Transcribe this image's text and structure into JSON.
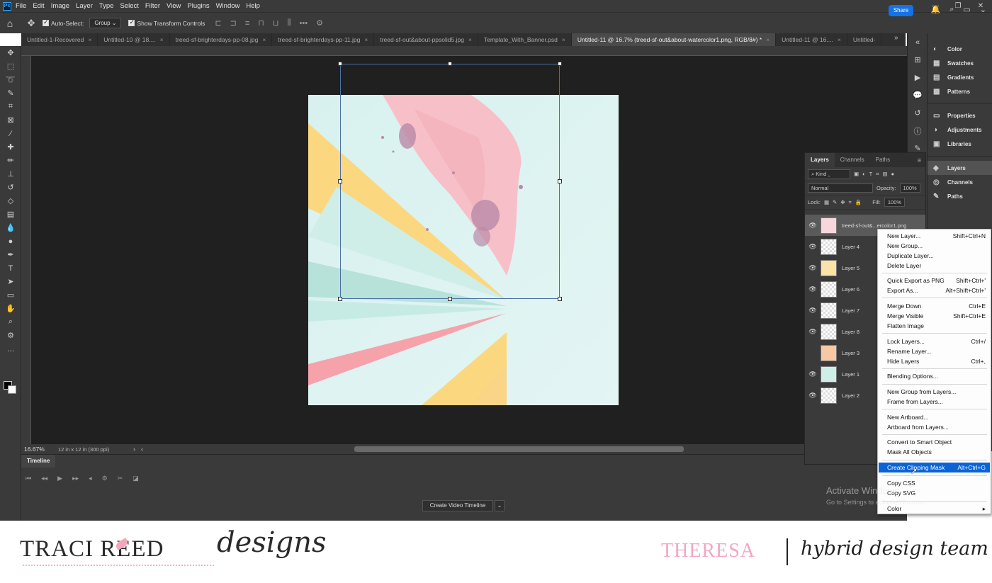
{
  "menubar": {
    "items": [
      "File",
      "Edit",
      "Image",
      "Layer",
      "Type",
      "Select",
      "Filter",
      "View",
      "Plugins",
      "Window",
      "Help"
    ],
    "window_controls": [
      "—",
      "❐",
      "✕"
    ]
  },
  "options": {
    "auto_select_label": "Auto-Select:",
    "auto_select_value": "Group",
    "show_transform_label": "Show Transform Controls",
    "share_label": "Share"
  },
  "tabs": [
    {
      "label": "Untitled-1-Recovered",
      "active": false
    },
    {
      "label": "Untitled-10 @ 18....",
      "active": false
    },
    {
      "label": "treed-sf-brighterdays-pp-08.jpg",
      "active": false
    },
    {
      "label": "treed-sf-brighterdays-pp-11.jpg",
      "active": false
    },
    {
      "label": "treed-sf-out&about-ppsolid5.jpg",
      "active": false
    },
    {
      "label": "Template_With_Banner.psd",
      "active": false
    },
    {
      "label": "Untitled-11 @ 16.7% (treed-sf-out&about-watercolor1.png, RGB/8#) *",
      "active": true
    },
    {
      "label": "Untitled-11 @ 16....",
      "active": false
    },
    {
      "label": "Untitled-",
      "active": false
    }
  ],
  "status": {
    "zoom": "16.67%",
    "doc_info": "12 in x 12 in (300 ppi)"
  },
  "timeline": {
    "tab_label": "Timeline",
    "create_button": "Create Video Timeline"
  },
  "dock": {
    "items": [
      {
        "icon": "color-icon",
        "glyph": "◐",
        "label": "Color"
      },
      {
        "icon": "swatches-icon",
        "glyph": "▦",
        "label": "Swatches"
      },
      {
        "icon": "gradients-icon",
        "glyph": "▤",
        "label": "Gradients"
      },
      {
        "icon": "patterns-icon",
        "glyph": "▩",
        "label": "Patterns"
      },
      {
        "icon": "properties-icon",
        "glyph": "▭",
        "label": "Properties"
      },
      {
        "icon": "adjustments-icon",
        "glyph": "◑",
        "label": "Adjustments"
      },
      {
        "icon": "libraries-icon",
        "glyph": "▣",
        "label": "Libraries"
      },
      {
        "icon": "layers-icon",
        "glyph": "◈",
        "label": "Layers"
      },
      {
        "icon": "channels-icon",
        "glyph": "◎",
        "label": "Channels"
      },
      {
        "icon": "paths-icon",
        "glyph": "✎",
        "label": "Paths"
      }
    ]
  },
  "layers_panel": {
    "tabs": [
      "Layers",
      "Channels",
      "Paths"
    ],
    "filter_label": "Kind",
    "blend_mode": "Normal",
    "opacity_label": "Opacity:",
    "opacity_value": "100%",
    "lock_label": "Lock:",
    "fill_label": "Fill:",
    "fill_value": "100%",
    "layers": [
      {
        "name": "treed-sf-out&...ercolor1.png",
        "visible": true
      },
      {
        "name": "Layer 4",
        "visible": true
      },
      {
        "name": "Layer 5",
        "visible": true
      },
      {
        "name": "Layer 6",
        "visible": true
      },
      {
        "name": "Layer 7",
        "visible": true
      },
      {
        "name": "Layer 8",
        "visible": true
      },
      {
        "name": "Layer 3",
        "visible": false
      },
      {
        "name": "Layer 1",
        "visible": true
      },
      {
        "name": "Layer 2",
        "visible": true
      }
    ]
  },
  "context_menu": {
    "items": [
      {
        "label": "New Layer...",
        "shortcut": "Shift+Ctrl+N"
      },
      {
        "label": "New Group...",
        "shortcut": ""
      },
      {
        "label": "Duplicate Layer...",
        "shortcut": ""
      },
      {
        "label": "Delete Layer",
        "shortcut": ""
      },
      {
        "label": "Quick Export as PNG",
        "shortcut": "Shift+Ctrl+'"
      },
      {
        "label": "Export As...",
        "shortcut": "Alt+Shift+Ctrl+'"
      },
      {
        "label": "Merge Down",
        "shortcut": "Ctrl+E"
      },
      {
        "label": "Merge Visible",
        "shortcut": "Shift+Ctrl+E"
      },
      {
        "label": "Flatten Image",
        "shortcut": ""
      },
      {
        "label": "Lock Layers...",
        "shortcut": "Ctrl+/"
      },
      {
        "label": "Rename Layer...",
        "shortcut": ""
      },
      {
        "label": "Hide Layers",
        "shortcut": "Ctrl+,"
      },
      {
        "label": "Blending Options...",
        "shortcut": ""
      },
      {
        "label": "New Group from Layers...",
        "shortcut": ""
      },
      {
        "label": "Frame from Layers...",
        "shortcut": ""
      },
      {
        "label": "New Artboard...",
        "shortcut": ""
      },
      {
        "label": "Artboard from Layers...",
        "shortcut": ""
      },
      {
        "label": "Convert to Smart Object",
        "shortcut": ""
      },
      {
        "label": "Mask All Objects",
        "shortcut": ""
      },
      {
        "label": "Create Clipping Mask",
        "shortcut": "Alt+Ctrl+G",
        "highlighted": true
      },
      {
        "label": "Copy CSS",
        "shortcut": ""
      },
      {
        "label": "Copy SVG",
        "shortcut": ""
      },
      {
        "label": "Color",
        "shortcut": "▸"
      }
    ]
  },
  "watermark": {
    "line1": "Activate Windows",
    "line2": "Go to Settings to activate Windows."
  },
  "banner": {
    "brand": "TRACI REED",
    "brand_script": "designs",
    "member": "THERESA",
    "team": "hybrid design team"
  },
  "colors": {
    "accent": "#1473e6",
    "menu_highlight": "#0a64d8",
    "brand_pink": "#f3a7c0"
  }
}
